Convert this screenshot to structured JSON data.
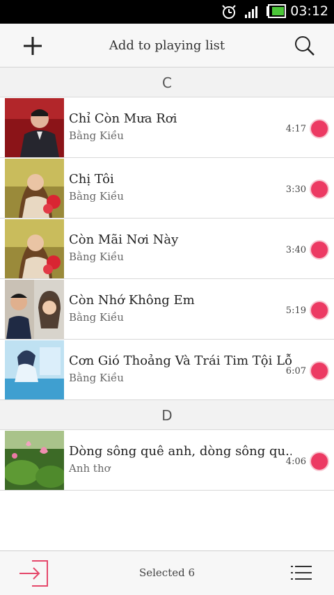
{
  "status_bar": {
    "time": "03:12",
    "icons": [
      "alarm-icon",
      "signal-icon",
      "battery-icon"
    ]
  },
  "header": {
    "title": "Add to playing list",
    "left_icon": "plus-icon",
    "right_icon": "search-icon"
  },
  "sections": [
    {
      "letter": "C",
      "songs": [
        {
          "title": "Chỉ Còn Mưa Rơi",
          "artist": "Bằng Kiều",
          "duration": "4:17"
        },
        {
          "title": "Chị Tôi",
          "artist": "Bằng Kiều",
          "duration": "3:30"
        },
        {
          "title": "Còn Mãi Nơi Này",
          "artist": "Bằng Kiều",
          "duration": "3:40"
        },
        {
          "title": "Còn Nhớ Không Em",
          "artist": "Bằng Kiều",
          "duration": "5:19"
        },
        {
          "title": "Cơn Gió Thoảng Và Trái Tim Tội Lỗi",
          "artist": "Bằng Kiều",
          "duration": "6:07"
        }
      ]
    },
    {
      "letter": "D",
      "songs": [
        {
          "title": "Dòng sông quê anh, dòng sông qu...",
          "artist": "Anh thơ",
          "duration": "4:06"
        }
      ]
    }
  ],
  "footer": {
    "selected_label": "Selected 6",
    "left_icon": "exit-icon",
    "right_icon": "list-icon"
  },
  "colors": {
    "accent": "#ec3a63",
    "exit_icon": "#e5476a"
  }
}
